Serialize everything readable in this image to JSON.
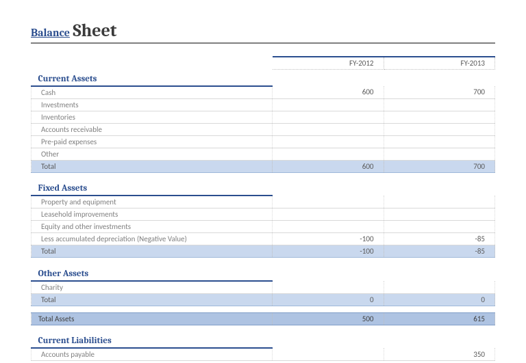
{
  "title": {
    "part1": "Balance",
    "part2": "Sheet"
  },
  "years": {
    "y1": "FY-2012",
    "y2": "FY-2013"
  },
  "sections": {
    "current_assets": {
      "heading": "Current Assets",
      "rows": [
        {
          "label": "Cash",
          "v1": "600",
          "v2": "700"
        },
        {
          "label": "Investments",
          "v1": "",
          "v2": ""
        },
        {
          "label": "Inventories",
          "v1": "",
          "v2": ""
        },
        {
          "label": "Accounts receivable",
          "v1": "",
          "v2": ""
        },
        {
          "label": "Pre-paid expenses",
          "v1": "",
          "v2": ""
        },
        {
          "label": "Other",
          "v1": "",
          "v2": ""
        }
      ],
      "total": {
        "label": "Total",
        "v1": "600",
        "v2": "700"
      }
    },
    "fixed_assets": {
      "heading": "Fixed Assets",
      "rows": [
        {
          "label": "Property and equipment",
          "v1": "",
          "v2": ""
        },
        {
          "label": "Leasehold improvements",
          "v1": "",
          "v2": ""
        },
        {
          "label": "Equity and other investments",
          "v1": "",
          "v2": ""
        },
        {
          "label": "Less accumulated depreciation (Negative Value)",
          "v1": "-100",
          "v2": "-85"
        }
      ],
      "total": {
        "label": "Total",
        "v1": "-100",
        "v2": "-85"
      }
    },
    "other_assets": {
      "heading": "Other Assets",
      "rows": [
        {
          "label": "Charity",
          "v1": "",
          "v2": ""
        }
      ],
      "total": {
        "label": "Total",
        "v1": "0",
        "v2": "0"
      }
    },
    "total_assets": {
      "label": "Total Assets",
      "v1": "500",
      "v2": "615"
    },
    "current_liabilities": {
      "heading": "Current Liabilities",
      "rows": [
        {
          "label": "Accounts payable",
          "v1": "",
          "v2": "350"
        }
      ]
    }
  }
}
